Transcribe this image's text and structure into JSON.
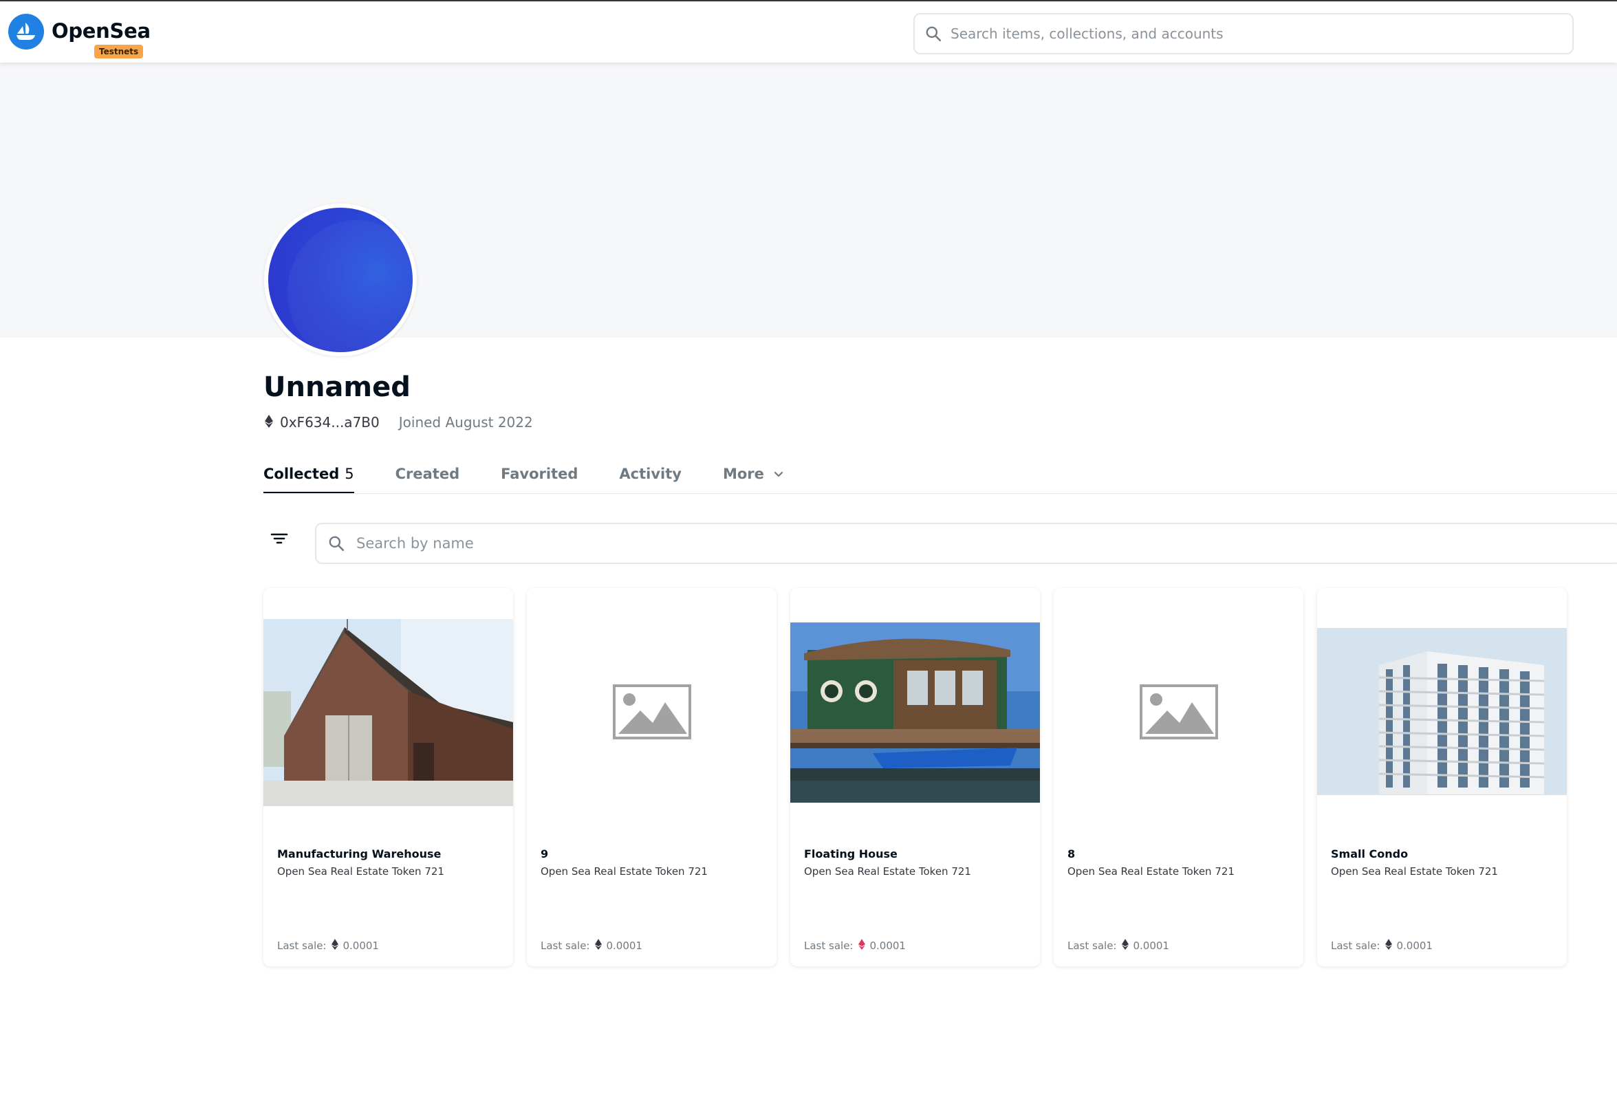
{
  "header": {
    "brand": "OpenSea",
    "badge": "Testnets",
    "search_placeholder": "Search items, collections, and accounts"
  },
  "profile": {
    "name": "Unnamed",
    "address": "0xF634...a7B0",
    "joined": "Joined August 2022"
  },
  "tabs": [
    {
      "label": "Collected",
      "count": "5",
      "active": true
    },
    {
      "label": "Created"
    },
    {
      "label": "Favorited"
    },
    {
      "label": "Activity"
    },
    {
      "label": "More"
    }
  ],
  "items_search": {
    "placeholder": "Search by name"
  },
  "cards": [
    {
      "title": "Manufacturing Warehouse",
      "collection": "Open Sea Real Estate Token 721",
      "sale_label": "Last sale:",
      "price": "0.0001",
      "image": "warehouse",
      "eth_color": "#353840"
    },
    {
      "title": "9",
      "collection": "Open Sea Real Estate Token 721",
      "sale_label": "Last sale:",
      "price": "0.0001",
      "image": "placeholder",
      "eth_color": "#353840"
    },
    {
      "title": "Floating House",
      "collection": "Open Sea Real Estate Token 721",
      "sale_label": "Last sale:",
      "price": "0.0001",
      "image": "houseboat",
      "eth_color": "#e0375c"
    },
    {
      "title": "8",
      "collection": "Open Sea Real Estate Token 721",
      "sale_label": "Last sale:",
      "price": "0.0001",
      "image": "placeholder",
      "eth_color": "#353840"
    },
    {
      "title": "Small Condo",
      "collection": "Open Sea Real Estate Token 721",
      "sale_label": "Last sale:",
      "price": "0.0001",
      "image": "condo",
      "eth_color": "#353840"
    }
  ],
  "colors": {
    "brand_blue": "#2081e2",
    "badge_orange": "#f7a44b",
    "avatar_blue": "#2b45d6"
  }
}
